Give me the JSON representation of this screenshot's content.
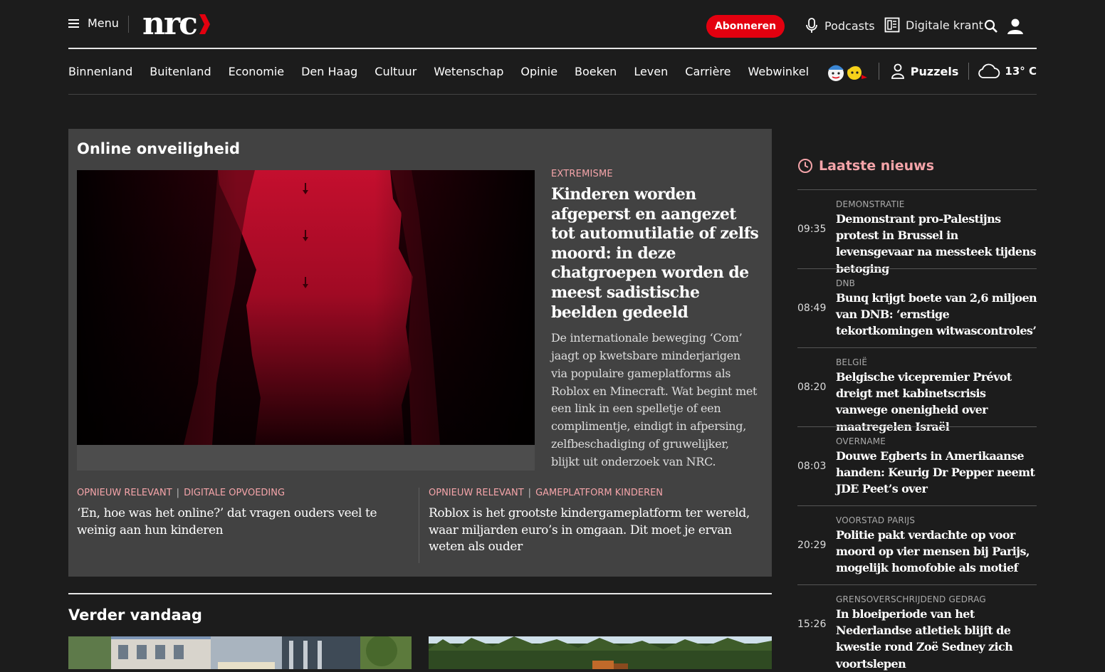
{
  "header": {
    "menu_label": "Menu",
    "logo_text": "nrc",
    "subscribe_label": "Abonneren",
    "podcasts_label": "Podcasts",
    "digital_paper_label": "Digitale krant"
  },
  "nav": {
    "items": [
      "Binnenland",
      "Buitenland",
      "Economie",
      "Den Haag",
      "Cultuur",
      "Wetenschap",
      "Opinie",
      "Boeken",
      "Leven",
      "Carrière",
      "Webwinkel"
    ],
    "puzzles_label": "Puzzels",
    "weather": "13° C"
  },
  "feature": {
    "section_title": "Online onveiligheid",
    "label": "EXTREMISME",
    "headline": "Kinderen worden afgeperst en aangezet tot automutilatie of zelfs moord: in deze chatgroepen worden de meest sadistische beelden gedeeld",
    "body": "De internationale beweging ‘Com’ jaagt op kwetsbare minderjarigen via populaire gameplatforms als Roblox en Minecraft. Wat begint met een link in een spelletje of een complimentje, eindigt in afpersing, zelfbeschadiging of gruwelijker, blijkt uit onderzoek van NRC.",
    "related": [
      {
        "label_1": "OPNIEUW RELEVANT",
        "label_2": "DIGITALE OPVOEDING",
        "headline": "‘En, hoe was het online?’ dat vragen ouders veel te weinig aan hun kinderen"
      },
      {
        "label_1": "OPNIEUW RELEVANT",
        "label_2": "GAMEPLATFORM KINDEREN",
        "headline": "Roblox is het grootste kindergameplatform ter wereld, waar miljarden euro’s in omgaan. Dit moet je ervan weten als ouder"
      }
    ]
  },
  "verder": {
    "title": "Verder vandaag"
  },
  "latest": {
    "title": "Laatste nieuws",
    "items": [
      {
        "time": "09:35",
        "category": "DEMONSTRATIE",
        "title": "Demonstrant pro-Palestijns protest in Brussel in levensgevaar na messteek tijdens betoging"
      },
      {
        "time": "08:49",
        "category": "DNB",
        "title": "Bunq krijgt boete van 2,6 miljoen van DNB: ‘ernstige tekortkomingen witwascontroles’"
      },
      {
        "time": "08:20",
        "category": "BELGIË",
        "title": "Belgische vicepremier Prévot dreigt met kabinetscrisis vanwege onenigheid over maatregelen Israël"
      },
      {
        "time": "08:03",
        "category": "OVERNAME",
        "title": "Douwe Egberts in Amerikaanse handen: Keurig Dr Pepper neemt JDE Peet’s over"
      },
      {
        "time": "20:29",
        "category": "VOORSTAD PARIJS",
        "title": "Politie pakt verdachte op voor moord op vier mensen bij Parijs, mogelijk homofobie als motief"
      },
      {
        "time": "15:26",
        "category": "GRENSOVERSCHRIJDEND GEDRAG",
        "title": "In bloeiperiode van het Nederlandse atletiek blijft de kwestie rond Zoë Sedney zich voortslepen"
      }
    ]
  },
  "colors": {
    "background": "#1c1c1c",
    "feature_background": "#424242",
    "accent_red": "#e3000f",
    "label_pink": "#f4a4a9"
  }
}
